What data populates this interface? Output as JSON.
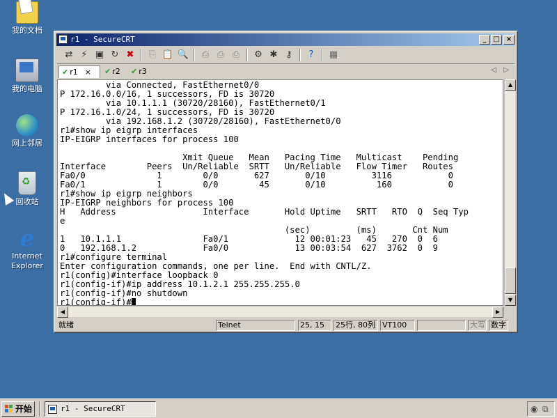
{
  "desktop": {
    "icons": [
      {
        "label": "我的文档",
        "icon": "my-documents-icon"
      },
      {
        "label": "我的电脑",
        "icon": "my-computer-icon"
      },
      {
        "label": "网上邻居",
        "icon": "network-places-icon"
      },
      {
        "label": "回收站",
        "icon": "recycle-bin-icon"
      },
      {
        "label": "Internet\nExplorer",
        "icon": "internet-explorer-icon"
      }
    ]
  },
  "window": {
    "title": "r1 - SecureCRT",
    "buttons": {
      "minimize": "_",
      "maximize": "□",
      "close": "×"
    }
  },
  "toolbar": {
    "icons": [
      "connect-icon",
      "quick-connect-icon",
      "connect-in-tab-icon",
      "reconnect-icon",
      "disconnect-icon",
      "copy-icon",
      "paste-icon",
      "find-icon",
      "print-icon",
      "print-selection-icon",
      "print-setup-icon",
      "session-options-icon",
      "global-options-icon",
      "keymap-icon",
      "help-icon",
      "sftp-icon"
    ]
  },
  "tabs": [
    {
      "label": "r1",
      "active": true,
      "close": "×"
    },
    {
      "label": "r2",
      "active": false
    },
    {
      "label": "r3",
      "active": false
    }
  ],
  "terminal": {
    "lines": [
      "         via Connected, FastEthernet0/0",
      "P 172.16.0.0/16, 1 successors, FD is 30720",
      "         via 10.1.1.1 (30720/28160), FastEthernet0/1",
      "P 172.16.1.0/24, 1 successors, FD is 30720",
      "         via 192.168.1.2 (30720/28160), FastEthernet0/0",
      "r1#show ip eigrp interfaces",
      "IP-EIGRP interfaces for process 100",
      "",
      "                        Xmit Queue   Mean   Pacing Time   Multicast    Pending",
      "Interface        Peers  Un/Reliable  SRTT   Un/Reliable   Flow Timer   Routes",
      "Fa0/0              1        0/0       627       0/10         3116           0",
      "Fa0/1              1        0/0        45       0/10          160           0",
      "r1#show ip eigrp neighbors",
      "IP-EIGRP neighbors for process 100",
      "H   Address                 Interface       Hold Uptime   SRTT   RTO  Q  Seq Typ",
      "e",
      "                                            (sec)         (ms)       Cnt Num",
      "1   10.1.1.1                Fa0/1             12 00:01:23   45   270  0  6",
      "0   192.168.1.2             Fa0/0             13 00:03:54  627  3762  0  9",
      "r1#configure terminal",
      "Enter configuration commands, one per line.  End with CNTL/Z.",
      "r1(config)#interface loopback 0",
      "r1(config-if)#ip address 10.1.2.1 255.255.255.0",
      "r1(config-if)#no shutdown",
      "r1(config-if)#"
    ]
  },
  "statusbar": {
    "ready": "就绪",
    "protocol": "Telnet",
    "cursor_pos": "25, 15",
    "size": "25行, 80列",
    "emulation": "VT100",
    "blank": "",
    "caps": "大写",
    "numlock": "数字"
  },
  "taskbar": {
    "start_label": "开始",
    "task_label": "r1 - SecureCRT",
    "tray_icons": [
      "volume-icon",
      "network-tray-icon"
    ]
  }
}
